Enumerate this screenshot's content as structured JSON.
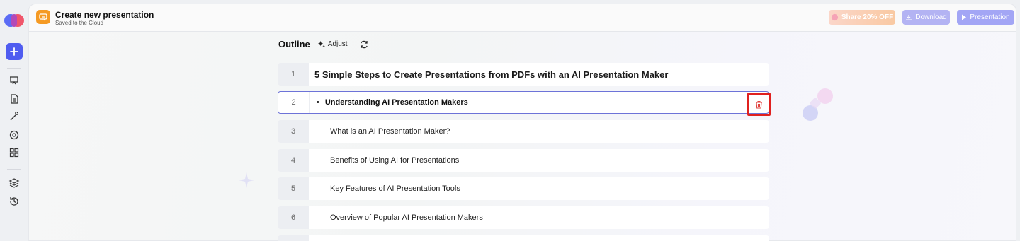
{
  "colors": {
    "accent": "#4f5cf0",
    "doc_icon": "#f59a23",
    "selected_border": "#6d73d8",
    "delete_highlight": "#e0211f",
    "delete_icon": "#e0413e"
  },
  "rail": {
    "icons": [
      "logo-icon",
      "plus-icon",
      "presentation-icon",
      "document-icon",
      "magic-wand-icon",
      "target-icon",
      "grid-icon",
      "layers-icon",
      "history-icon"
    ]
  },
  "header": {
    "title": "Create new presentation",
    "subtitle": "Saved to the Cloud",
    "share_label": "Share 20% OFF",
    "download_label": "Download",
    "presentation_label": "Presentation"
  },
  "outline": {
    "heading": "Outline",
    "adjust_label": "Adjust",
    "rows": [
      {
        "num": "1",
        "text": "5 Simple Steps to Create Presentations from PDFs with an AI Presentation Maker"
      },
      {
        "num": "2",
        "bullet": "•",
        "text": "Understanding AI Presentation Makers"
      },
      {
        "num": "3",
        "text": "What is an AI Presentation Maker?"
      },
      {
        "num": "4",
        "text": "Benefits of Using AI for Presentations"
      },
      {
        "num": "5",
        "text": "Key Features of AI Presentation Tools"
      },
      {
        "num": "6",
        "text": "Overview of Popular AI Presentation Makers"
      }
    ]
  }
}
